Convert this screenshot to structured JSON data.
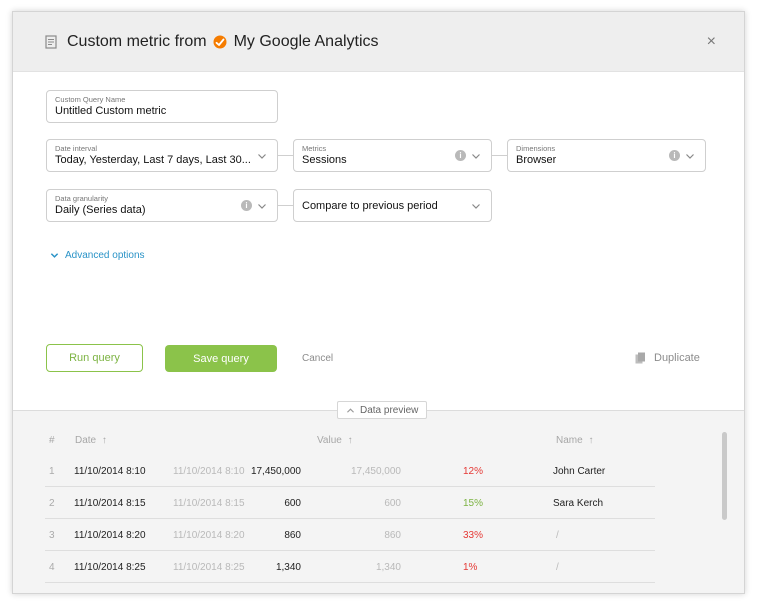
{
  "header": {
    "title_prefix": "Custom metric from",
    "source_name": "My Google Analytics",
    "close_glyph": "×"
  },
  "form": {
    "query_name": {
      "label": "Custom Query Name",
      "value": "Untitled Custom metric"
    },
    "date_interval": {
      "label": "Date interval",
      "value": "Today, Yesterday, Last 7 days, Last 30..."
    },
    "metrics": {
      "label": "Metrics",
      "value": "Sessions"
    },
    "dimensions": {
      "label": "Dimensions",
      "value": "Browser"
    },
    "data_granularity": {
      "label": "Data granularity",
      "value": "Daily (Series data)"
    },
    "compare": {
      "value": "Compare to previous period"
    }
  },
  "advanced_label": "Advanced options",
  "actions": {
    "run": "Run query",
    "save": "Save query",
    "cancel": "Cancel",
    "duplicate": "Duplicate"
  },
  "preview": {
    "tab_label": "Data preview",
    "columns": {
      "num": "#",
      "date": "Date",
      "value": "Value",
      "name": "Name"
    },
    "rows": [
      {
        "num": "1",
        "date": "11/10/2014 8:10",
        "prev_date": "11/10/2014 8:10",
        "value": "17,450,000",
        "prev_value": "17,450,000",
        "pct": "12%",
        "pct_color": "#e53935",
        "name": "John Carter"
      },
      {
        "num": "2",
        "date": "11/10/2014 8:15",
        "prev_date": "11/10/2014 8:15",
        "value": "600",
        "prev_value": "600",
        "pct": "15%",
        "pct_color": "#7cb342",
        "name": "Sara Kerch"
      },
      {
        "num": "3",
        "date": "11/10/2014 8:20",
        "prev_date": "11/10/2014 8:20",
        "value": "860",
        "prev_value": "860",
        "pct": "33%",
        "pct_color": "#e53935",
        "name": "/"
      },
      {
        "num": "4",
        "date": "11/10/2014 8:25",
        "prev_date": "11/10/2014 8:25",
        "value": "1,340",
        "prev_value": "1,340",
        "pct": "1%",
        "pct_color": "#e53935",
        "name": "/"
      }
    ]
  },
  "colors": {
    "accent_green": "#8bc34a",
    "link_blue": "#2a93c7",
    "ga_orange": "#f57c00"
  }
}
